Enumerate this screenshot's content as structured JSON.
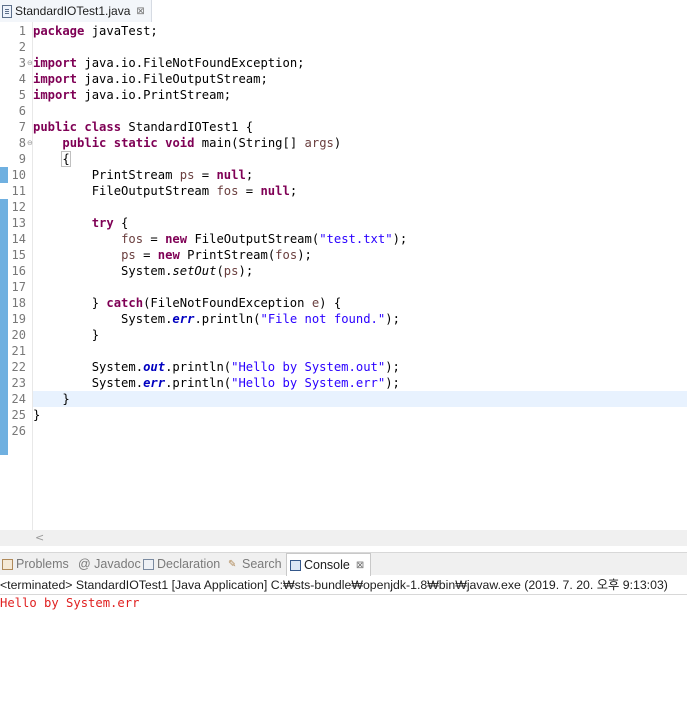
{
  "editor_tab": {
    "title": "StandardIOTest1.java",
    "close_icon": "close-icon"
  },
  "lines": [
    {
      "n": "1",
      "parts": [
        {
          "t": "package",
          "c": "kw"
        },
        {
          "t": " javaTest;"
        }
      ]
    },
    {
      "n": "2",
      "parts": []
    },
    {
      "n": "3",
      "fold": "⊖",
      "parts": [
        {
          "t": "import",
          "c": "kw"
        },
        {
          "t": " java.io.FileNotFoundException;"
        }
      ]
    },
    {
      "n": "4",
      "parts": [
        {
          "t": "import",
          "c": "kw"
        },
        {
          "t": " java.io.FileOutputStream;"
        }
      ]
    },
    {
      "n": "5",
      "parts": [
        {
          "t": "import",
          "c": "kw"
        },
        {
          "t": " java.io.PrintStream;"
        }
      ]
    },
    {
      "n": "6",
      "parts": []
    },
    {
      "n": "7",
      "parts": [
        {
          "t": "public",
          "c": "kw"
        },
        {
          "t": " "
        },
        {
          "t": "class",
          "c": "kw"
        },
        {
          "t": " StandardIOTest1 {"
        }
      ]
    },
    {
      "n": "8",
      "fold": "⊖",
      "parts": [
        {
          "t": "    "
        },
        {
          "t": "public",
          "c": "kw"
        },
        {
          "t": " "
        },
        {
          "t": "static",
          "c": "kw"
        },
        {
          "t": " "
        },
        {
          "t": "void",
          "c": "kw"
        },
        {
          "t": " main(String[] "
        },
        {
          "t": "args",
          "c": "var"
        },
        {
          "t": ")"
        }
      ]
    },
    {
      "n": "9",
      "parts": [
        {
          "t": "    "
        },
        {
          "t": "{",
          "c": "brk"
        }
      ]
    },
    {
      "n": "10",
      "parts": [
        {
          "t": "        PrintStream "
        },
        {
          "t": "ps",
          "c": "var"
        },
        {
          "t": " = "
        },
        {
          "t": "null",
          "c": "kw"
        },
        {
          "t": ";"
        }
      ]
    },
    {
      "n": "11",
      "parts": [
        {
          "t": "        FileOutputStream "
        },
        {
          "t": "fos",
          "c": "var"
        },
        {
          "t": " = "
        },
        {
          "t": "null",
          "c": "kw"
        },
        {
          "t": ";"
        }
      ]
    },
    {
      "n": "12",
      "parts": []
    },
    {
      "n": "13",
      "parts": [
        {
          "t": "        "
        },
        {
          "t": "try",
          "c": "kw"
        },
        {
          "t": " {"
        }
      ]
    },
    {
      "n": "14",
      "parts": [
        {
          "t": "            "
        },
        {
          "t": "fos",
          "c": "var"
        },
        {
          "t": " = "
        },
        {
          "t": "new",
          "c": "kw"
        },
        {
          "t": " FileOutputStream("
        },
        {
          "t": "\"test.txt\"",
          "c": "str"
        },
        {
          "t": ");"
        }
      ]
    },
    {
      "n": "15",
      "parts": [
        {
          "t": "            "
        },
        {
          "t": "ps",
          "c": "var"
        },
        {
          "t": " = "
        },
        {
          "t": "new",
          "c": "kw"
        },
        {
          "t": " PrintStream("
        },
        {
          "t": "fos",
          "c": "var"
        },
        {
          "t": ");"
        }
      ]
    },
    {
      "n": "16",
      "parts": [
        {
          "t": "            System."
        },
        {
          "t": "setOut",
          "c": "smeth"
        },
        {
          "t": "("
        },
        {
          "t": "ps",
          "c": "var"
        },
        {
          "t": ");"
        }
      ]
    },
    {
      "n": "17",
      "parts": []
    },
    {
      "n": "18",
      "parts": [
        {
          "t": "        } "
        },
        {
          "t": "catch",
          "c": "kw"
        },
        {
          "t": "(FileNotFoundException "
        },
        {
          "t": "e",
          "c": "var"
        },
        {
          "t": ") {"
        }
      ]
    },
    {
      "n": "19",
      "parts": [
        {
          "t": "            System."
        },
        {
          "t": "err",
          "c": "field"
        },
        {
          "t": ".println("
        },
        {
          "t": "\"File not found.\"",
          "c": "str"
        },
        {
          "t": ");"
        }
      ]
    },
    {
      "n": "20",
      "parts": [
        {
          "t": "        }"
        }
      ]
    },
    {
      "n": "21",
      "parts": []
    },
    {
      "n": "22",
      "parts": [
        {
          "t": "        System."
        },
        {
          "t": "out",
          "c": "field"
        },
        {
          "t": ".println("
        },
        {
          "t": "\"Hello by System.out\"",
          "c": "str"
        },
        {
          "t": ");"
        }
      ]
    },
    {
      "n": "23",
      "parts": [
        {
          "t": "        System."
        },
        {
          "t": "err",
          "c": "field"
        },
        {
          "t": ".println("
        },
        {
          "t": "\"Hello by System.err\"",
          "c": "str"
        },
        {
          "t": ");"
        }
      ]
    },
    {
      "n": "24",
      "current": true,
      "parts": [
        {
          "t": "    }"
        }
      ]
    },
    {
      "n": "25",
      "parts": [
        {
          "t": "}"
        }
      ]
    },
    {
      "n": "26",
      "parts": []
    }
  ],
  "scroll_left_arrow": "<",
  "view_tabs": [
    {
      "label": "Problems",
      "icon": "problems-icon",
      "active": false
    },
    {
      "label": "@ Javadoc",
      "icon": "javadoc-icon",
      "active": false
    },
    {
      "label": "Declaration",
      "icon": "declaration-icon",
      "active": false
    },
    {
      "label": "Search",
      "icon": "search-icon",
      "active": false
    },
    {
      "label": "Console",
      "icon": "console-icon",
      "active": true,
      "close": "⊠"
    }
  ],
  "console": {
    "description": "<terminated> StandardIOTest1 [Java Application] C:₩sts-bundle₩openjdk-1.8₩bin₩javaw.exe (2019. 7. 20. 오후 9:13:03)",
    "output": "Hello by System.err"
  },
  "colors": {
    "keyword": "#7f0055",
    "string": "#2a00ff",
    "field": "#0000c0",
    "stderr": "#e02020",
    "current_line": "#e8f2fe"
  }
}
